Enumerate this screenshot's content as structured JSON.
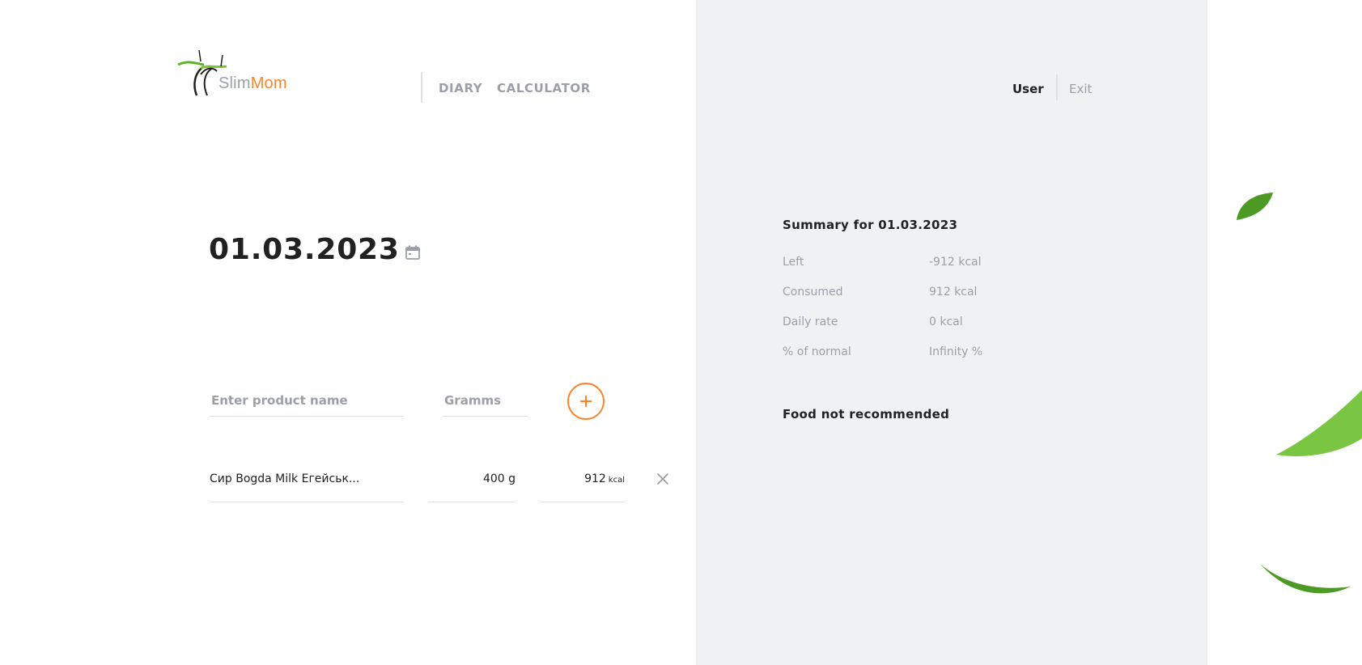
{
  "header": {
    "logo": {
      "part1": "Slim",
      "part2": "Mom"
    },
    "nav": {
      "diary": "DIARY",
      "calculator": "CALCULATOR"
    },
    "user": {
      "name": "User",
      "exit": "Exit"
    }
  },
  "diary": {
    "date": "01.03.2023",
    "form": {
      "product_placeholder": "Enter product name",
      "grams_placeholder": "Gramms",
      "add_label": "+"
    },
    "entries": [
      {
        "name": "Сир Bogda Milk Егейськ...",
        "grams": "400 g",
        "kcal": "912",
        "kcal_unit": "kcal"
      }
    ]
  },
  "summary": {
    "title": "Summary for 01.03.2023",
    "rows": [
      {
        "label": "Left",
        "value": "-912 kcal"
      },
      {
        "label": "Consumed",
        "value": "912 kcal"
      },
      {
        "label": "Daily rate",
        "value": "0 kcal"
      },
      {
        "label": "% of normal",
        "value": "Infinity %"
      }
    ],
    "food_title": "Food not recommended"
  },
  "colors": {
    "accent": "#fc842d",
    "muted": "#9b9faa",
    "dark": "#212121",
    "panel": "#f0f1f3",
    "leaf": "#5fb32b"
  },
  "icons": [
    "calendar-icon",
    "plus-icon",
    "close-icon",
    "logo-icon",
    "leaf-decoration"
  ]
}
